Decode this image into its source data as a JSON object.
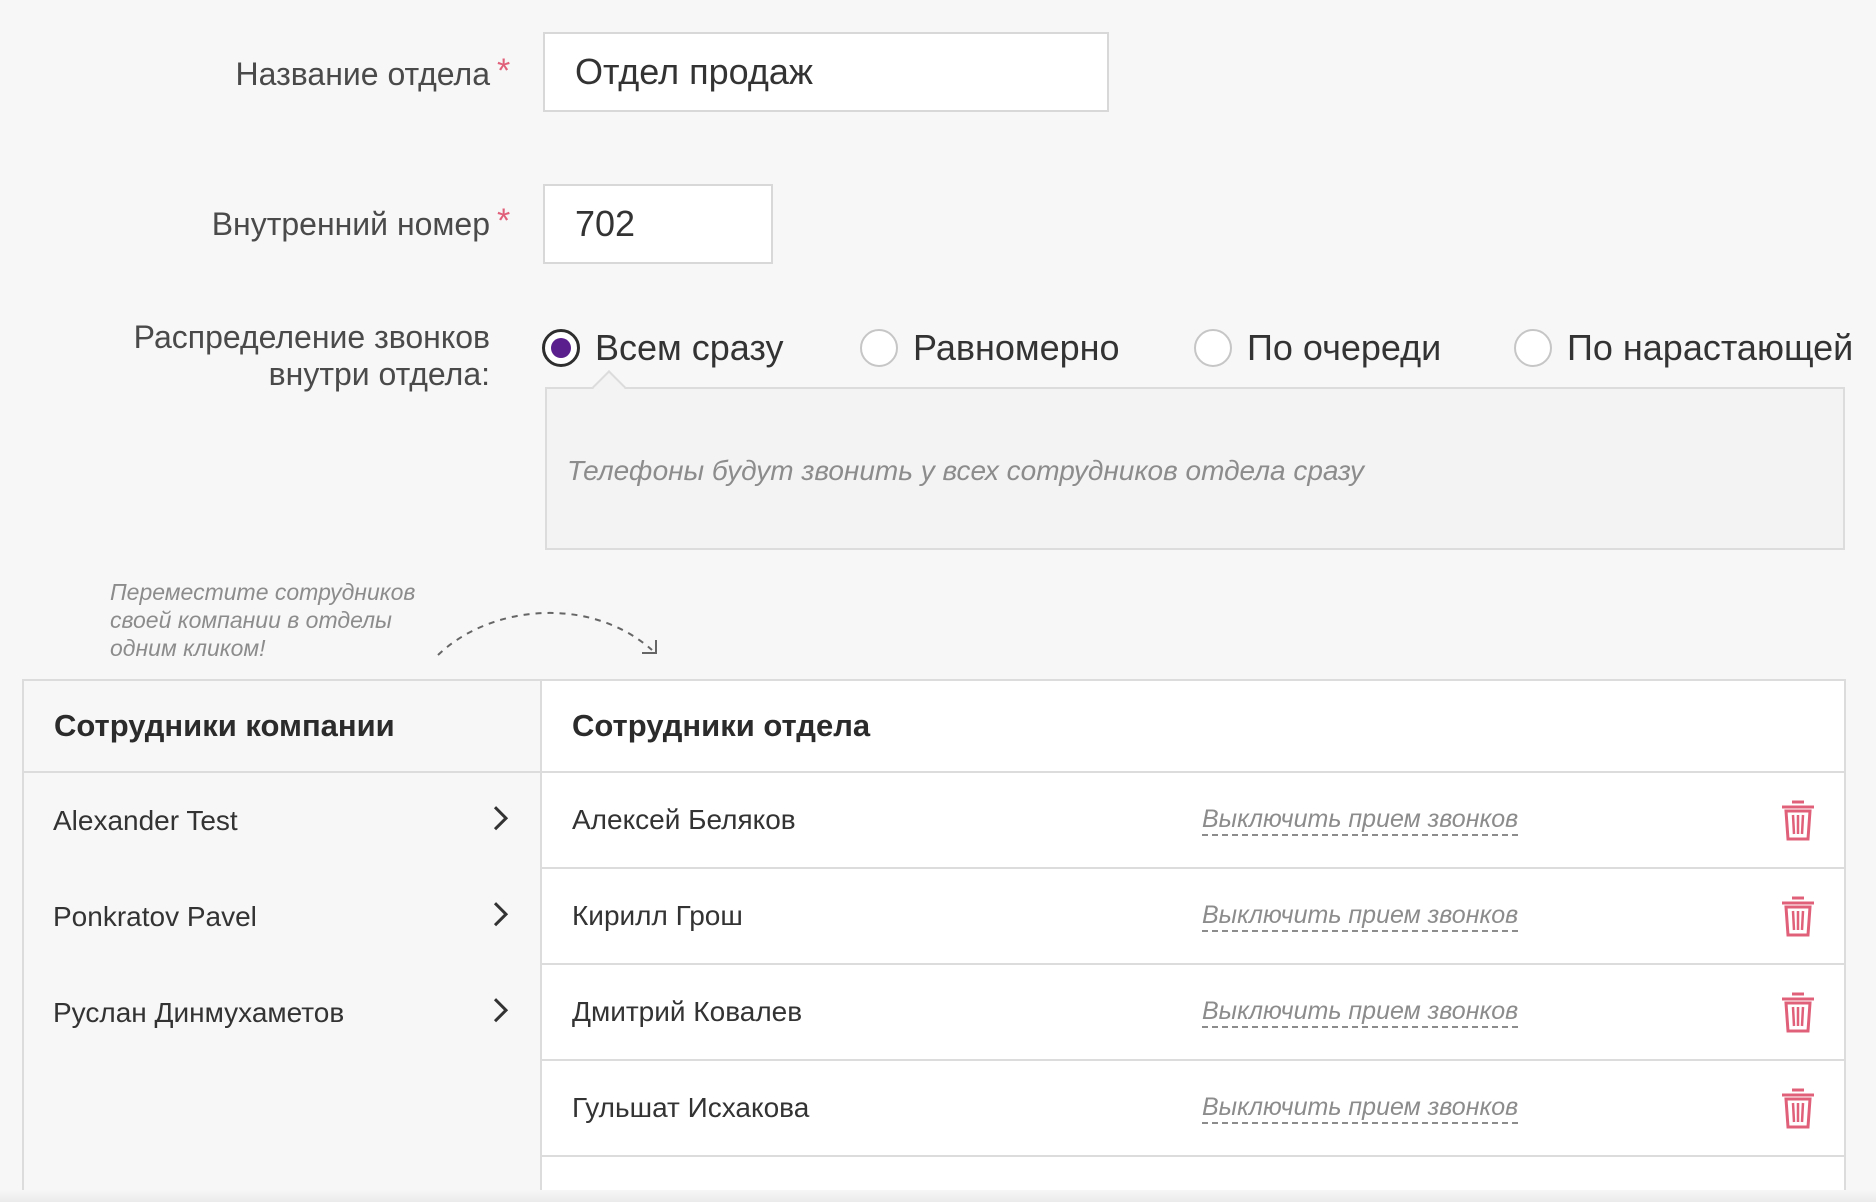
{
  "form": {
    "department_name": {
      "label": "Название отдела",
      "required_mark": "*",
      "value": "Отдел продаж"
    },
    "extension": {
      "label": "Внутренний номер",
      "required_mark": "*",
      "value": "702"
    },
    "distribution": {
      "label_line1": "Распределение звонков",
      "label_line2": "внутри отдела:",
      "options": [
        {
          "label": "Всем сразу",
          "checked": true
        },
        {
          "label": "Равномерно",
          "checked": false
        },
        {
          "label": "По очереди",
          "checked": false
        },
        {
          "label": "По нарастающей",
          "checked": false
        }
      ],
      "description": "Телефоны будут звонить у всех сотрудников отдела сразу"
    }
  },
  "hint": {
    "line1": "Переместите сотрудников",
    "line2": "своей компании в отделы",
    "line3": "одним кликом!"
  },
  "company_panel": {
    "title": "Сотрудники компании",
    "items": [
      {
        "name": "Alexander Test"
      },
      {
        "name": "Ponkratov Pavel"
      },
      {
        "name": "Руслан Динмухаметов"
      }
    ]
  },
  "department_panel": {
    "title": "Сотрудники отдела",
    "rows": [
      {
        "name": "Алексей Беляков",
        "action": "Выключить прием звонков"
      },
      {
        "name": "Кирилл Грош",
        "action": "Выключить прием звонков"
      },
      {
        "name": "Дмитрий Ковалев",
        "action": "Выключить прием звонков"
      },
      {
        "name": "Гульшат Исхакова",
        "action": "Выключить прием звонков"
      }
    ]
  },
  "colors": {
    "background": "#f7f7f7",
    "required": "#e0607a",
    "radio_checked": "#5a1f8c",
    "trash_icon": "#e0607a",
    "border": "#dcdcdc"
  }
}
